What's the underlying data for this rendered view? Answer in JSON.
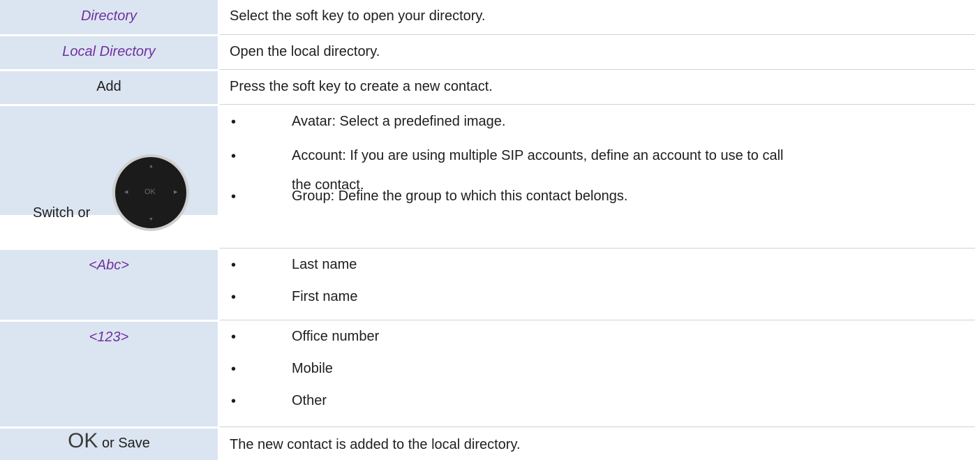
{
  "rows": [
    {
      "key": "Directory",
      "desc": "Select the soft key to open your directory."
    },
    {
      "key": "Local Directory",
      "desc": "Open the local directory."
    },
    {
      "key": "Add",
      "desc": "Press the soft key to create a new contact."
    },
    {
      "key": "Switch or",
      "navkey": {
        "center": "OK",
        "up": "▲",
        "down": "▼",
        "left": "◀",
        "right": "▶"
      },
      "bullets": [
        "Avatar: Select a predefined image.",
        "Account: If you are using multiple SIP accounts, define an account to use to call",
        "the contact.",
        "Group: Define the group to which this contact belongs."
      ]
    },
    {
      "key": "<Abc>",
      "bullets": [
        "Last name",
        "First name"
      ]
    },
    {
      "key": "<123>",
      "bullets": [
        "Office number",
        "Mobile",
        "Other"
      ]
    },
    {
      "key_ok": "OK",
      "key_rest": "or Save",
      "desc": "The new contact is added to the local directory."
    }
  ],
  "bullet_symbol": "•"
}
